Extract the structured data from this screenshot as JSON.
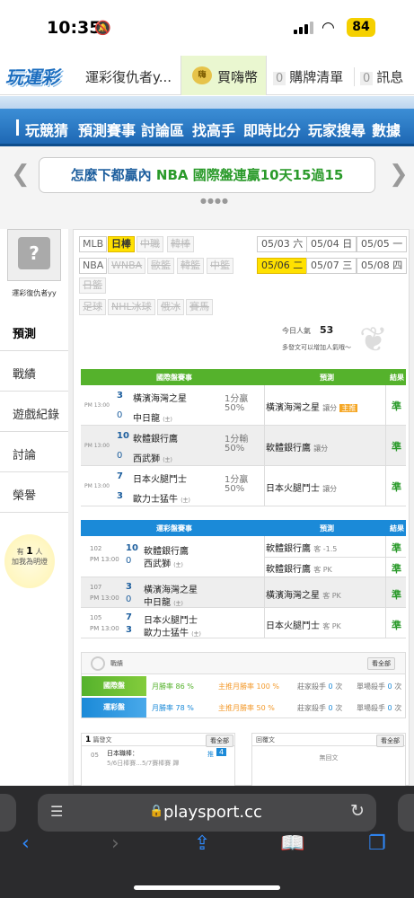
{
  "status": {
    "time": "10:35",
    "battery": "84"
  },
  "topbar": {
    "logo": "玩運彩",
    "tab_title": "運彩復仇者y...",
    "coin_label": "買嗨幣",
    "cart_count": "0",
    "cart_label": "購牌清單",
    "msg_count": "0",
    "msg_label": "訊息"
  },
  "nav": {
    "items": [
      "玩競猜",
      "預測賽事",
      "討論區",
      "找高手",
      "即時比分",
      "玩家搜尋",
      "數據"
    ]
  },
  "banner": {
    "text_a": "怎麼下都贏內",
    "text_b": "NBA 國際盤連贏10天15過15"
  },
  "user": {
    "name": "運彩復仇者yy"
  },
  "leftmenu": [
    "預測",
    "戰績",
    "遊戲紀錄",
    "討論",
    "榮譽"
  ],
  "bulb": {
    "line1": "有",
    "count": "1",
    "line1b": "人",
    "line2": "加我為明燈"
  },
  "sports_row1": [
    "MLB",
    "日棒",
    "中職",
    "韓棒"
  ],
  "sports_row2": [
    "NBA",
    "WNBA",
    "歐籃",
    "韓籃",
    "中籃"
  ],
  "sports_row3": [
    "日籃"
  ],
  "sports_row4": [
    "足球",
    "NHL冰球",
    "俄冰",
    "賽馬"
  ],
  "dates": [
    "05/03 六",
    "05/04 日",
    "05/05 一",
    "05/06 二",
    "05/07 三",
    "05/08 四"
  ],
  "popularity": {
    "label": "今日人氣",
    "value": "53",
    "hint": "多發文可以增加人氣哦～"
  },
  "intl": {
    "header": "國際盤賽事",
    "pred_header": "預測",
    "res_header": "結果",
    "games": [
      {
        "time": "PM 13:00",
        "away_n": "3",
        "away": "橫濱海灣之星",
        "home_n": "0",
        "home": "中日龍",
        "hcap": "(主)",
        "odd1": "1分贏",
        "odd2": "50%",
        "pick": "橫濱海灣之星",
        "pick_tag": "讓分",
        "result": "準"
      },
      {
        "time": "PM 13:00",
        "away_n": "10",
        "away": "軟體銀行鷹",
        "home_n": "0",
        "home": "西武獅",
        "hcap": "(主)",
        "odd1": "1分輸",
        "odd2": "50%",
        "pick": "軟體銀行鷹",
        "pick_tag": "讓分",
        "result": "準"
      },
      {
        "time": "PM 13:00",
        "away_n": "7",
        "away": "日本火腿鬥士",
        "home_n": "3",
        "home": "歐力士猛牛",
        "hcap": "(主)",
        "odd1": "1分贏",
        "odd2": "50%",
        "pick": "日本火腿鬥士",
        "pick_tag": "讓分",
        "result": "準"
      }
    ]
  },
  "sport_lottery": {
    "header": "運彩盤賽事",
    "pred_header": "預測",
    "res_header": "結果",
    "games": [
      {
        "id": "102",
        "time": "PM 13:00",
        "away_n": "10",
        "away": "軟體銀行鷹",
        "home_n": "0",
        "home": "西武獅",
        "hcap": "(主)",
        "picks": [
          {
            "team": "軟體銀行鷹",
            "tag": "客 -1.5",
            "result": "準"
          },
          {
            "team": "軟體銀行鷹",
            "tag": "客 PK",
            "result": "準"
          }
        ]
      },
      {
        "id": "107",
        "time": "PM 13:00",
        "away_n": "3",
        "away": "橫濱海灣之星",
        "home_n": "0",
        "home": "中日龍",
        "hcap": "(主)",
        "picks": [
          {
            "team": "橫濱海灣之星",
            "tag": "客 PK",
            "result": "準"
          }
        ]
      },
      {
        "id": "105",
        "time": "PM 13:00",
        "away_n": "7",
        "away": "日本火腿鬥士",
        "home_n": "3",
        "home": "歐力士猛牛",
        "hcap": "(主)",
        "picks": [
          {
            "team": "日本火腿鬥士",
            "tag": "客 PK",
            "result": "準"
          }
        ]
      }
    ]
  },
  "stats": {
    "title": "戰績",
    "view_all": "看全部",
    "rows": [
      {
        "tag": "國際盤",
        "month": "月勝率",
        "month_pct": "86",
        "main": "主推月勝率",
        "main_pct": "100",
        "z": "莊家殺手",
        "z_n": "0",
        "z_u": "次",
        "s": "單場殺手",
        "s_n": "0",
        "s_u": "次"
      },
      {
        "tag": "運彩盤",
        "month": "月勝率",
        "month_pct": "78",
        "main": "主推月勝率",
        "main_pct": "50",
        "z": "莊家殺手",
        "z_n": "0",
        "z_u": "次",
        "s": "單場殺手",
        "s_n": "0",
        "s_u": "次"
      }
    ]
  },
  "posts": {
    "count": "1",
    "label": "篇發文",
    "view_all": "看全部",
    "item_day": "05",
    "item_title": "日本職棒：",
    "item_sub": "5/6日棒賽...5/7賽棒賽 蹕",
    "item_badge": "推",
    "item_n": "4"
  },
  "replies": {
    "label": "回覆文",
    "view_all": "看全部",
    "empty": "無回文"
  },
  "browser": {
    "url": "playsport.cc"
  }
}
